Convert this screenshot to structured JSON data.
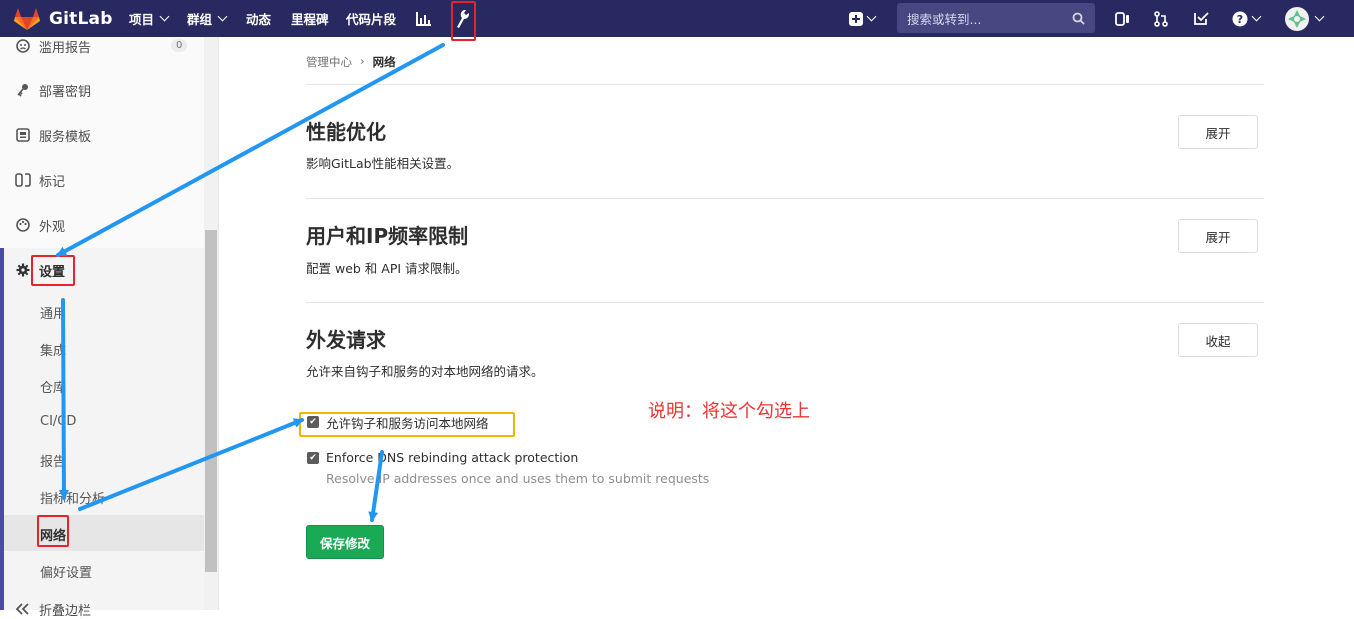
{
  "navbar": {
    "brand": "GitLab",
    "links": [
      {
        "label": "项目",
        "dropdown": true
      },
      {
        "label": "群组",
        "dropdown": true
      },
      {
        "label": "动态",
        "dropdown": false
      },
      {
        "label": "里程碑",
        "dropdown": false
      },
      {
        "label": "代码片段",
        "dropdown": false
      }
    ],
    "search_placeholder": "搜索或转到...",
    "icons": [
      "chart-icon",
      "admin-wrench-icon",
      "plus-icon",
      "issues-icon",
      "merge-request-icon",
      "todo-icon",
      "help-icon",
      "avatar"
    ]
  },
  "sidebar": {
    "items": [
      {
        "label": "滥用报告",
        "icon": "abuse-report-icon",
        "count": "0"
      },
      {
        "label": "部署密钥",
        "icon": "key-icon"
      },
      {
        "label": "服务模板",
        "icon": "service-template-icon"
      },
      {
        "label": "标记",
        "icon": "labels-icon"
      },
      {
        "label": "外观",
        "icon": "appearance-icon"
      },
      {
        "label": "设置",
        "icon": "gear-icon"
      }
    ],
    "subitems": [
      "通用",
      "集成",
      "仓库",
      "CI/CD",
      "报告",
      "指标和分析",
      "网络",
      "偏好设置"
    ],
    "active_subitem": "网络",
    "collapse_label": "折叠边栏"
  },
  "breadcrumb": {
    "parent": "管理中心",
    "current": "网络"
  },
  "sections": [
    {
      "title": "性能优化",
      "desc": "影响GitLab性能相关设置。",
      "button": "展开"
    },
    {
      "title": "用户和IP频率限制",
      "desc": "配置 web 和 API 请求限制。",
      "button": "展开"
    },
    {
      "title": "外发请求",
      "desc": "允许来自钩子和服务的对本地网络的请求。",
      "button": "收起"
    }
  ],
  "outbound": {
    "allow_local_label": "允许钩子和服务访问本地网络",
    "allow_local_checked": true,
    "dns_label": "Enforce DNS rebinding attack protection",
    "dns_checked": true,
    "dns_help": "Resolve IP addresses once and uses them to submit requests",
    "save_button": "保存修改"
  },
  "annotation": "说明：将这个勾选上",
  "colors": {
    "navbar": "#292961",
    "highlight_red": "#e3242b",
    "highlight_yellow": "#f5b300",
    "arrow_blue": "#2196f3",
    "save_green": "#1aaa55"
  }
}
